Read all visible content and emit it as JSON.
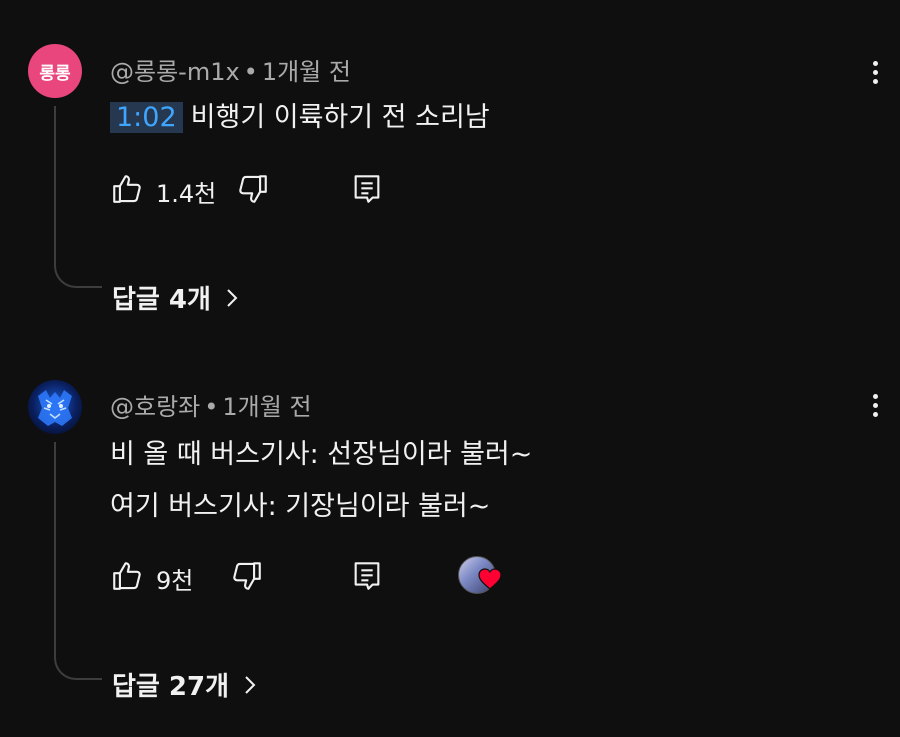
{
  "comments": [
    {
      "avatar": {
        "text": "롱롱",
        "color": "#e8467c"
      },
      "author": "@롱롱-m1x",
      "separator": "•",
      "time": "1개월 전",
      "timestamp_link": "1:02",
      "text": "비행기 이륙하기 전 소리남",
      "likes": "1.4천",
      "replies_label": "답글 4개"
    },
    {
      "avatar": {
        "icon": "tiger-avatar-icon"
      },
      "author": "@호랑좌",
      "separator": "•",
      "time": "1개월 전",
      "text_lines": [
        "비 올 때 버스기사: 선장님이라 불러~",
        "여기 버스기사: 기장님이라 불러~"
      ],
      "likes": "9천",
      "creator_heart": true,
      "replies_label": "답글 27개"
    }
  ],
  "colors": {
    "background": "#0f0f0f",
    "text": "#f1f1f1",
    "secondary_text": "#aaaaaa",
    "link": "#3ea6ff",
    "heart": "#ff0033"
  }
}
